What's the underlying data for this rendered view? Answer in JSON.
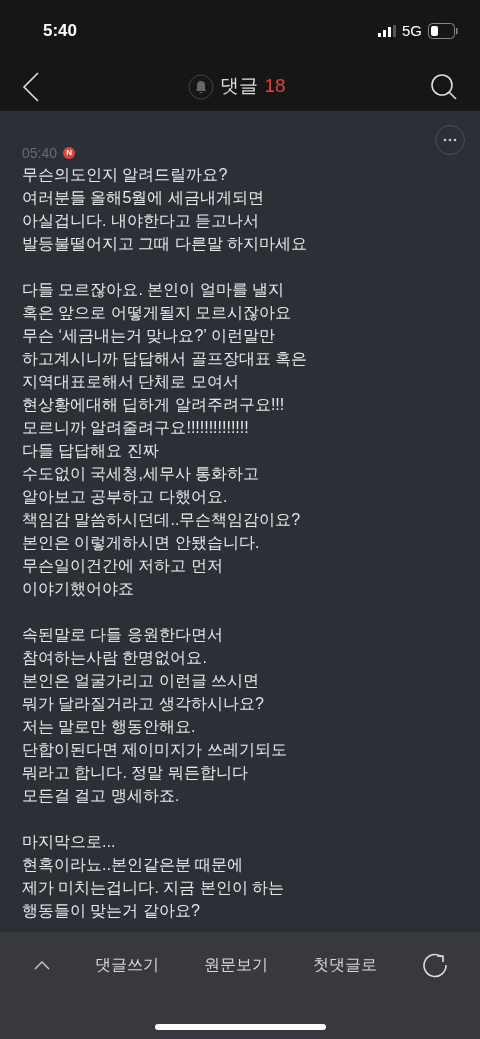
{
  "status_bar": {
    "time": "5:40",
    "network": "5G"
  },
  "header": {
    "title": "댓글",
    "count": "18"
  },
  "comment": {
    "time": "05:40",
    "badge": "N",
    "paragraphs": [
      "무슨의도인지 알려드릴까요?\n여러분들 올해5월에 세금내게되면\n아실겁니다. 내야한다고 듣고나서\n발등불떨어지고 그때 다른말 하지마세요",
      "다들 모르잖아요. 본인이 얼마를 낼지\n혹은 앞으로 어떻게될지 모르시잖아요\n무슨 ‘세금내는거 맞나요?’ 이런말만\n하고계시니까 답답해서 골프장대표 혹은\n지역대표로해서 단체로 모여서\n현상황에대해 딥하게 알려주려구요!!!\n모르니까 알려줄려구요!!!!!!!!!!!!!!\n다들 답답해요 진짜\n수도없이 국세청,세무사 통화하고\n알아보고 공부하고 다했어요.\n책임감 말씀하시던데..무슨책임감이요?\n본인은 이렇게하시면 안됐습니다.\n무슨일이건간에 저하고 먼저\n이야기했어야죠",
      "속된말로 다들 응원한다면서\n참여하는사람 한명없어요.\n본인은 얼굴가리고 이런글 쓰시면\n뭐가 달라질거라고 생각하시나요?\n저는 말로만 행동안해요.\n단합이된다면 제이미지가 쓰레기되도\n뭐라고 합니다. 정말 뭐든합니다\n모든걸 걸고 맹세하죠.",
      "마지막으로...\n현혹이라뇨..본인같은분 때문에\n제가 미치는겁니다. 지금 본인이 하는\n행동들이 맞는거 같아요?"
    ]
  },
  "toolbar": {
    "buttons": [
      "댓글쓰기",
      "원문보기",
      "첫댓글로"
    ]
  }
}
